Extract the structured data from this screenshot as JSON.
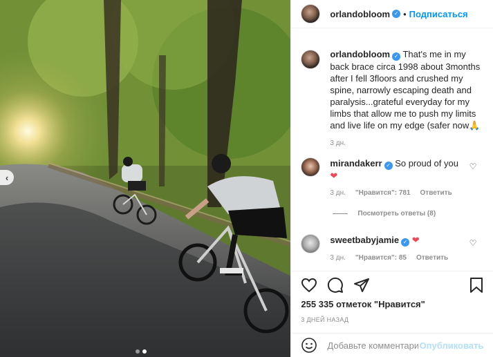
{
  "post": {
    "author": "orlandobloom",
    "follow_label": "Подписаться",
    "separator": "•",
    "caption": "That's me in my back brace circa 1998 about 3months after I fell 3floors and crushed my spine, narrowly escaping death and paralysis...grateful everyday for my limbs that allow me to push my limits and live life on my edge (safer now🙏",
    "caption_time": "3 дн.",
    "likes_text": "255 335 отметок \"Нравится\"",
    "posted_time": "3 ДНЕЙ НАЗАД"
  },
  "comments": [
    {
      "username": "mirandakerr",
      "text": "So proud of you",
      "emoji": "❤",
      "time": "3 дн.",
      "likes": "\"Нравится\": 781",
      "reply_label": "Ответить"
    },
    {
      "username": "sweetbabyjamie",
      "text": "",
      "emoji": "❤",
      "time": "3 дн.",
      "likes": "\"Нравится\": 85",
      "reply_label": "Ответить"
    }
  ],
  "view_replies": "Посмотреть ответы (8)",
  "add_comment": {
    "placeholder": "Добавьте комментарий...",
    "publish_label": "Опубликовать"
  },
  "carousel": {
    "current_slide": 2,
    "total_slides": 2
  },
  "colors": {
    "accent": "#0095f6",
    "verified": "#3897f0",
    "heart_red": "#ed4956",
    "muted_text": "#8e8e8e"
  },
  "icons": [
    "chevron-left-icon",
    "verified-icon",
    "heart-icon",
    "comment-icon",
    "share-icon",
    "bookmark-icon",
    "emoji-icon"
  ]
}
